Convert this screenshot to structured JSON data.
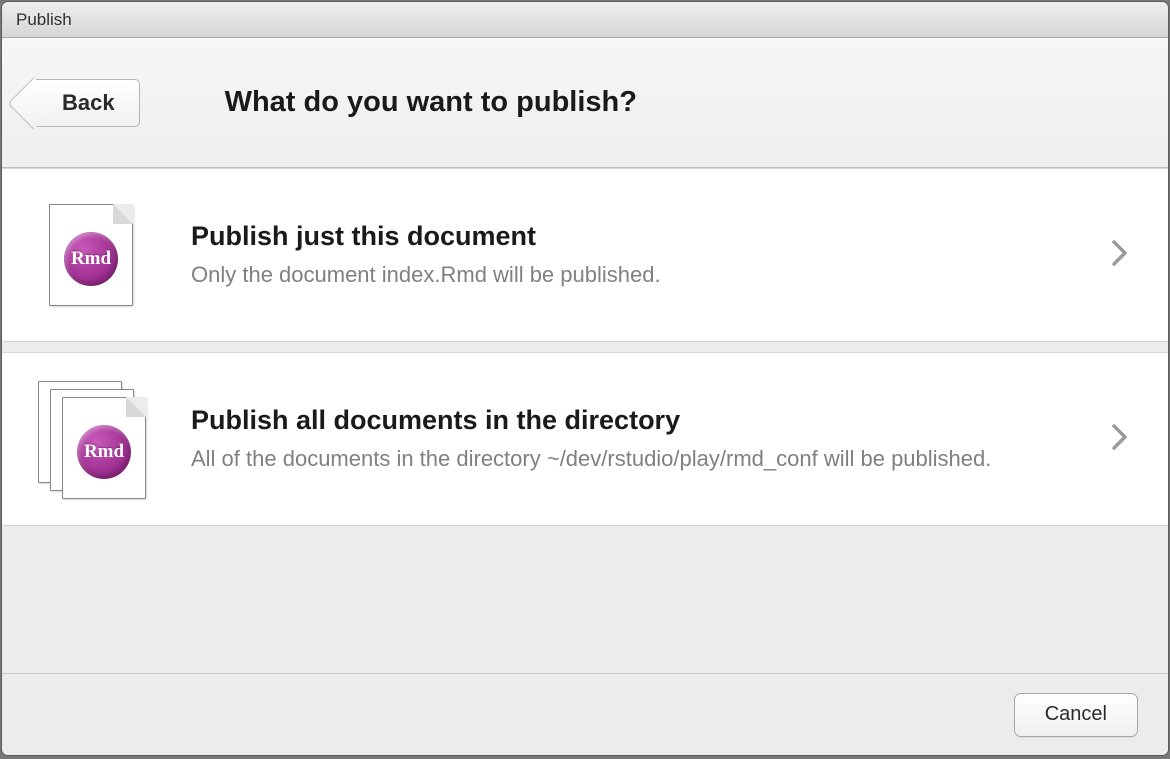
{
  "window": {
    "title": "Publish"
  },
  "header": {
    "back_label": "Back",
    "title": "What do you want to publish?"
  },
  "icon_badge_text": "Rmd",
  "options": [
    {
      "title": "Publish just this document",
      "description": "Only the document index.Rmd will be published."
    },
    {
      "title": "Publish all documents in the directory",
      "description": "All of the documents in the directory ~/dev/rstudio/play/rmd_conf will be published."
    }
  ],
  "footer": {
    "cancel_label": "Cancel"
  }
}
